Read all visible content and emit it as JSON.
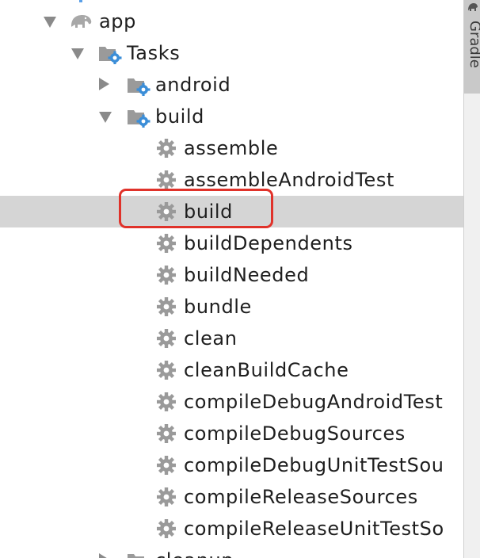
{
  "tree": {
    "root": {
      "label": "app",
      "icon": "gradle-elephant-icon",
      "expanded": true
    },
    "tasks": {
      "label": "Tasks",
      "icon": "task-folder-icon",
      "expanded": true
    },
    "android": {
      "label": "android",
      "icon": "task-folder-icon",
      "expanded": false
    },
    "build_group": {
      "label": "build",
      "icon": "task-folder-icon",
      "expanded": true
    },
    "build_tasks": [
      "assemble",
      "assembleAndroidTest",
      "build",
      "buildDependents",
      "buildNeeded",
      "bundle",
      "clean",
      "cleanBuildCache",
      "compileDebugAndroidTest",
      "compileDebugSources",
      "compileDebugUnitTestSou",
      "compileReleaseSources",
      "compileReleaseUnitTestSo"
    ],
    "selected_task": "build",
    "next_group": {
      "label": "cleanup",
      "icon": "task-folder-icon",
      "expanded": false
    }
  },
  "sidebar": {
    "tab_label": "Gradle",
    "tab_icon": "gradle-elephant-icon"
  },
  "colors": {
    "selection": "#d5d5d5",
    "highlight_border": "#e0322a",
    "gear": "#9a9a9a",
    "folder": "#9a9a9a",
    "gear_accent": "#3b8ed8"
  }
}
